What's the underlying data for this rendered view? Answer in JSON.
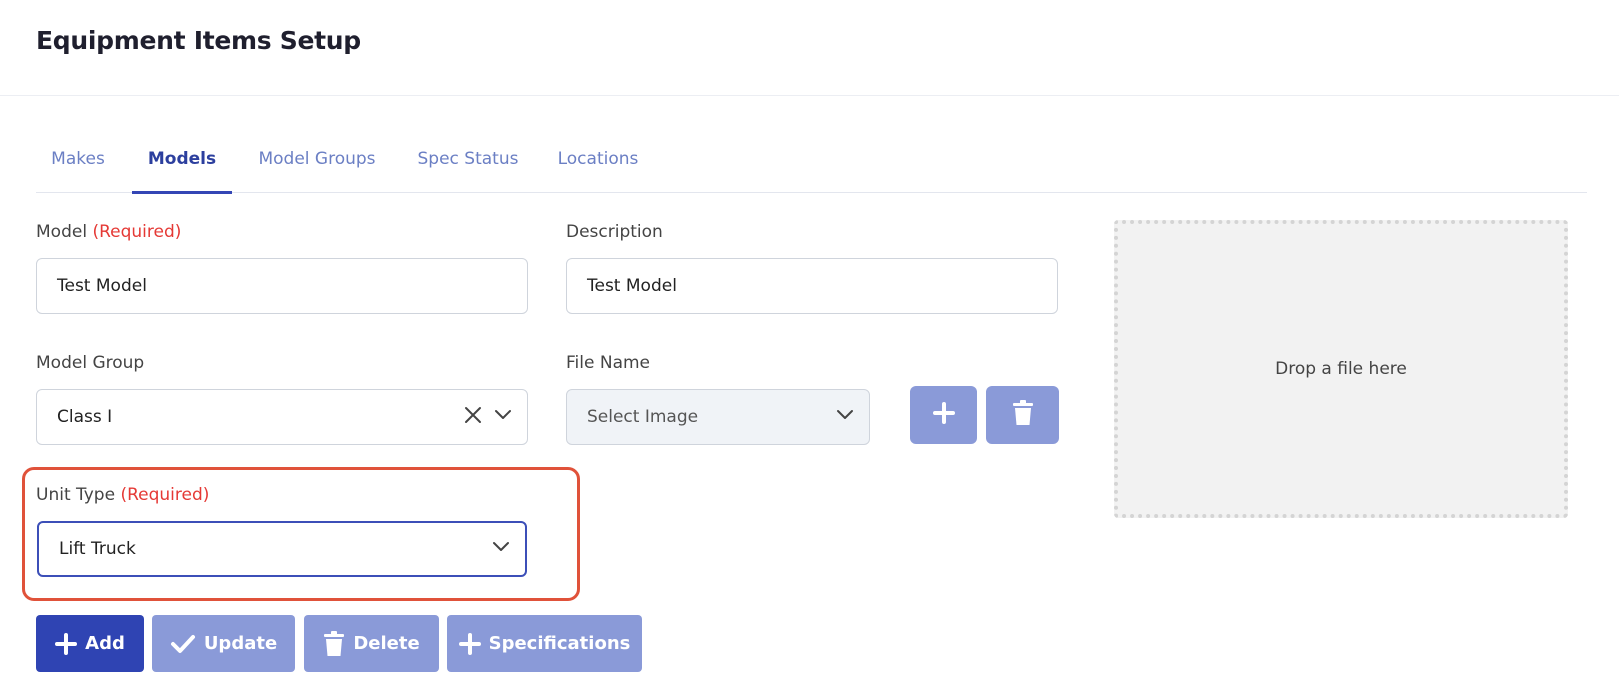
{
  "page": {
    "title": "Equipment Items Setup"
  },
  "tabs": [
    {
      "label": "Makes"
    },
    {
      "label": "Models"
    },
    {
      "label": "Model Groups"
    },
    {
      "label": "Spec Status"
    },
    {
      "label": "Locations"
    }
  ],
  "active_tab": "Models",
  "form": {
    "model": {
      "label": "Model",
      "required": "(Required)",
      "value": "Test Model"
    },
    "description": {
      "label": "Description",
      "value": "Test Model"
    },
    "model_group": {
      "label": "Model Group",
      "value": "Class I"
    },
    "file_name": {
      "label": "File Name",
      "placeholder": "Select Image"
    },
    "unit_type": {
      "label": "Unit Type",
      "required": "(Required)",
      "value": "Lift Truck"
    }
  },
  "dropzone": {
    "text": "Drop a file here"
  },
  "actions": {
    "add": "Add",
    "update": "Update",
    "delete": "Delete",
    "specifications": "Specifications"
  },
  "icons": {
    "add_image": "plus-icon",
    "delete_image": "trash-icon",
    "clear": "close-icon",
    "dropdown": "chevron-down-icon",
    "update": "check-icon"
  },
  "colors": {
    "primary": "#2f44b3",
    "primary_muted": "#8a9ad8",
    "required": "#e53935",
    "highlight": "#e0523a",
    "tab_inactive": "#6b7fc4",
    "tab_active": "#2c3f9e"
  }
}
